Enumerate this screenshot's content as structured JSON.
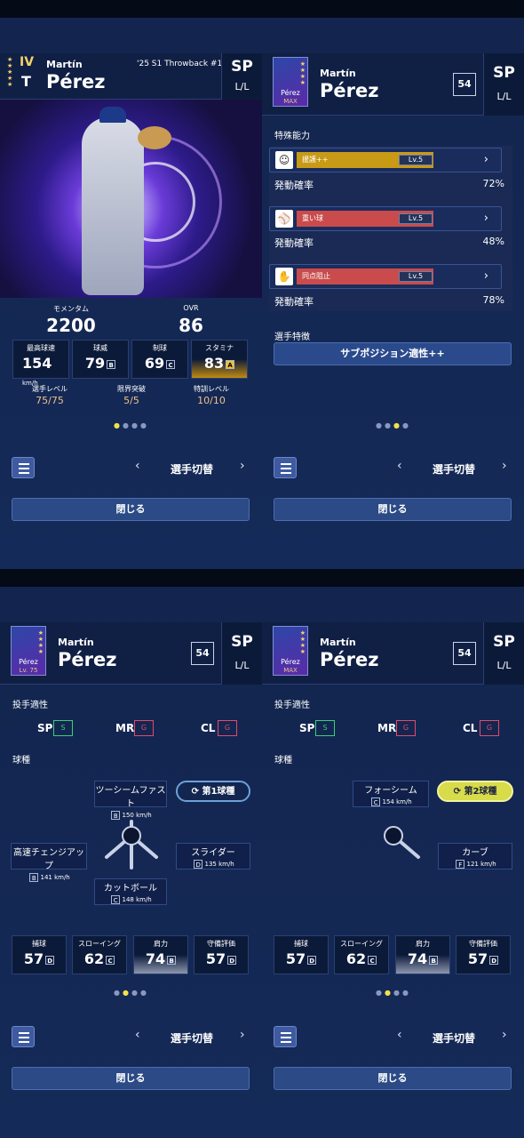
{
  "player": {
    "first": "Martín",
    "last": "Pérez",
    "position": "SP",
    "hand": "L/L",
    "card_name": "Pérez",
    "max_label": "MAX",
    "lv_label": "Lv. 75",
    "series": "'25 S1 Throwback #1",
    "rank_roman": "IV",
    "number": "54"
  },
  "panel1": {
    "momentum_label": "モメンタム",
    "momentum": "2200",
    "ovr_label": "OVR",
    "ovr": "86",
    "stats": [
      {
        "label": "最高球速",
        "value": "154",
        "unit": "km/h",
        "grade": ""
      },
      {
        "label": "球威",
        "value": "79",
        "grade": "B"
      },
      {
        "label": "制球",
        "value": "69",
        "grade": "C"
      },
      {
        "label": "スタミナ",
        "value": "83",
        "grade": "A"
      }
    ],
    "levels": [
      {
        "label": "選手レベル",
        "value": "75/75"
      },
      {
        "label": "限界突破",
        "value": "5/5"
      },
      {
        "label": "特訓レベル",
        "value": "10/10"
      }
    ]
  },
  "panel2": {
    "special_title": "特殊能力",
    "abilities": [
      {
        "name": "援護++",
        "lv": "Lv.5",
        "prob_label": "発動確率",
        "prob": "72%",
        "color": "#c89a15"
      },
      {
        "name": "重い球",
        "lv": "Lv.5",
        "prob_label": "発動確率",
        "prob": "48%",
        "color": "#c94b4b"
      },
      {
        "name": "同点阻止",
        "lv": "Lv.5",
        "prob_label": "発動確率",
        "prob": "78%",
        "color": "#c94b4b"
      }
    ],
    "trait_title": "選手特徴",
    "trait": "サブポジション適性++"
  },
  "aptitude": {
    "title": "投手適性",
    "items": [
      {
        "label": "SP",
        "grade": "S"
      },
      {
        "label": "MR",
        "grade": "G"
      },
      {
        "label": "CL",
        "grade": "G"
      }
    ]
  },
  "pitches_title": "球種",
  "panel3": {
    "tag": "第1球種",
    "pitches": [
      {
        "name": "ツーシームファスト",
        "grade": "B",
        "speed": "150 km/h"
      },
      {
        "name": "高速チェンジアップ",
        "grade": "B",
        "speed": "141 km/h"
      },
      {
        "name": "スライダー",
        "grade": "D",
        "speed": "135 km/h"
      },
      {
        "name": "カットボール",
        "grade": "C",
        "speed": "148 km/h"
      }
    ]
  },
  "panel4": {
    "tag": "第2球種",
    "pitches": [
      {
        "name": "フォーシーム",
        "grade": "C",
        "speed": "154 km/h"
      },
      {
        "name": "カーブ",
        "grade": "F",
        "speed": "121 km/h"
      }
    ]
  },
  "fielding": [
    {
      "label": "捕球",
      "value": "57",
      "grade": "D"
    },
    {
      "label": "スローイング",
      "value": "62",
      "grade": "C"
    },
    {
      "label": "肩力",
      "value": "74",
      "grade": "B"
    },
    {
      "label": "守備評価",
      "value": "57",
      "grade": "D"
    }
  ],
  "nav": {
    "switch_label": "選手切替",
    "close_label": "閉じる",
    "prev": "‹",
    "next": "›"
  }
}
